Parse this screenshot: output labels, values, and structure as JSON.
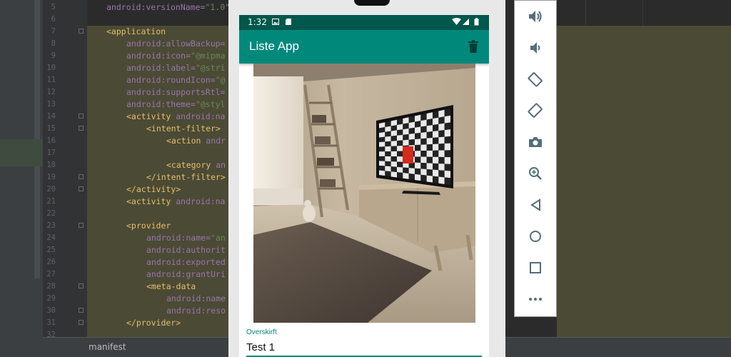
{
  "editor": {
    "tab_label": "manifest",
    "lines": [
      {
        "n": "5",
        "indent": 0,
        "parts": [
          [
            "attr",
            "android:versionName="
          ],
          [
            "val",
            "\"1.0\""
          ]
        ]
      },
      {
        "n": "6",
        "indent": 0,
        "parts": []
      },
      {
        "n": "7",
        "indent": 0,
        "parts": [
          [
            "tag",
            "<application"
          ]
        ]
      },
      {
        "n": "8",
        "indent": 1,
        "parts": [
          [
            "attr",
            "android:allowBackup="
          ]
        ]
      },
      {
        "n": "9",
        "indent": 1,
        "parts": [
          [
            "attr",
            "android:icon="
          ],
          [
            "val",
            "\"@mipma"
          ]
        ]
      },
      {
        "n": "10",
        "indent": 1,
        "parts": [
          [
            "attr",
            "android:label="
          ],
          [
            "val",
            "\"@stri"
          ]
        ]
      },
      {
        "n": "11",
        "indent": 1,
        "parts": [
          [
            "attr",
            "android:roundIcon="
          ],
          [
            "val",
            "\"@"
          ]
        ]
      },
      {
        "n": "12",
        "indent": 1,
        "parts": [
          [
            "attr",
            "android:supportsRtl="
          ]
        ]
      },
      {
        "n": "13",
        "indent": 1,
        "parts": [
          [
            "attr",
            "android:theme="
          ],
          [
            "val",
            "\"@styl"
          ]
        ]
      },
      {
        "n": "14",
        "indent": 1,
        "parts": [
          [
            "tag",
            "<activity "
          ],
          [
            "attr",
            "android:na"
          ]
        ]
      },
      {
        "n": "15",
        "indent": 2,
        "parts": [
          [
            "tag",
            "<intent-filter>"
          ]
        ]
      },
      {
        "n": "16",
        "indent": 3,
        "parts": [
          [
            "tag",
            "<action "
          ],
          [
            "attr",
            "andr"
          ]
        ]
      },
      {
        "n": "17",
        "indent": 0,
        "parts": []
      },
      {
        "n": "18",
        "indent": 3,
        "parts": [
          [
            "tag",
            "<category "
          ],
          [
            "attr",
            "an"
          ]
        ]
      },
      {
        "n": "19",
        "indent": 2,
        "parts": [
          [
            "tag",
            "</intent-filter>"
          ]
        ]
      },
      {
        "n": "20",
        "indent": 1,
        "parts": [
          [
            "tag",
            "</activity>"
          ]
        ]
      },
      {
        "n": "21",
        "indent": 1,
        "parts": [
          [
            "tag",
            "<activity "
          ],
          [
            "attr",
            "android:na"
          ]
        ]
      },
      {
        "n": "22",
        "indent": 0,
        "parts": []
      },
      {
        "n": "23",
        "indent": 1,
        "parts": [
          [
            "tag",
            "<provider"
          ]
        ]
      },
      {
        "n": "24",
        "indent": 2,
        "parts": [
          [
            "attr",
            "android:name="
          ],
          [
            "val",
            "\"an"
          ]
        ]
      },
      {
        "n": "25",
        "indent": 2,
        "parts": [
          [
            "attr",
            "android:authorit"
          ]
        ]
      },
      {
        "n": "26",
        "indent": 2,
        "parts": [
          [
            "attr",
            "android:exported"
          ]
        ]
      },
      {
        "n": "27",
        "indent": 2,
        "parts": [
          [
            "attr",
            "android:grantUri"
          ]
        ]
      },
      {
        "n": "28",
        "indent": 2,
        "parts": [
          [
            "tag",
            "<meta-data"
          ]
        ]
      },
      {
        "n": "29",
        "indent": 3,
        "parts": [
          [
            "attr",
            "android:name"
          ]
        ]
      },
      {
        "n": "30",
        "indent": 3,
        "parts": [
          [
            "attr",
            "android:reso"
          ]
        ]
      },
      {
        "n": "31",
        "indent": 1,
        "parts": [
          [
            "tag",
            "</provider>"
          ]
        ]
      },
      {
        "n": "32",
        "indent": 0,
        "parts": []
      }
    ]
  },
  "phone": {
    "status_time": "1:32",
    "app_title": "Liste App",
    "field_label": "Overskirft",
    "field_value": "Test 1",
    "colors": {
      "primary": "#00897b",
      "primary_dark": "#00574b"
    }
  },
  "toolbar": {
    "buttons": [
      "volume-up-icon",
      "volume-down-icon",
      "rotate-left-icon",
      "rotate-right-icon",
      "camera-icon",
      "zoom-icon",
      "back-icon",
      "home-icon",
      "overview-icon",
      "more-icon"
    ]
  }
}
